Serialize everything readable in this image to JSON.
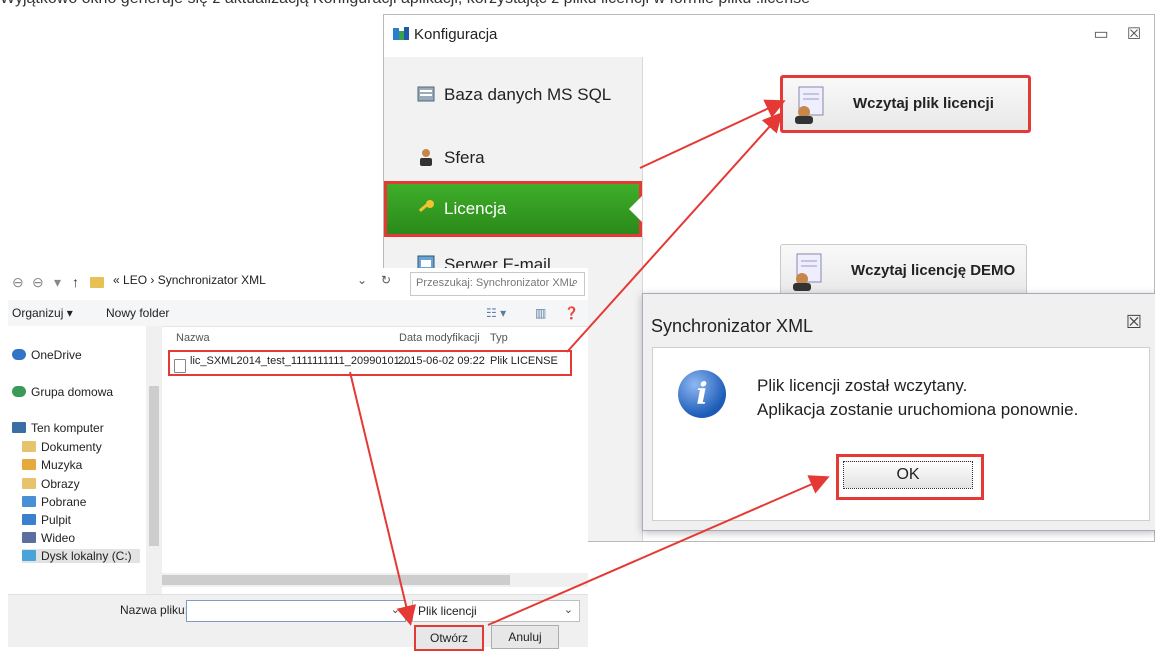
{
  "intro_text": "Wyjątkowo okno generuje się z aktualizacją Konfiguracji aplikacji, korzystając z pliku licencji w formie pliku .license",
  "konfiguracja": {
    "title": "Konfiguracja",
    "minimize": "▭",
    "close": "☒",
    "nav": [
      "Baza danych MS SQL",
      "Sfera",
      "Licencja",
      "Serwer E-mail"
    ],
    "active_index": 2,
    "buttons": {
      "load_license": "Wczytaj plik licencji",
      "load_demo": "Wczytaj licencję DEMO"
    }
  },
  "file_dialog": {
    "path": [
      "«",
      "LEO",
      "›",
      "Synchronizator XML"
    ],
    "search_placeholder": "Przeszukaj: Synchronizator XML",
    "toolbar": {
      "organize": "Organizuj ▾",
      "new_folder": "Nowy folder"
    },
    "tree": {
      "onedrive": "OneDrive",
      "homegroup": "Grupa domowa",
      "computer": "Ten komputer",
      "folders": [
        "Dokumenty",
        "Muzyka",
        "Obrazy",
        "Pobrane",
        "Pulpit",
        "Wideo",
        "Dysk lokalny (C:)"
      ]
    },
    "columns": {
      "name": "Nazwa",
      "date": "Data modyfikacji",
      "type": "Typ"
    },
    "file": {
      "name": "lic_SXML2014_test_1111111111_20990101....",
      "date": "2015-06-02 09:22",
      "type": "Plik LICENSE"
    },
    "filename_label": "Nazwa pliku:",
    "filename_value": "",
    "filter": "Plik licencji",
    "open": "Otwórz",
    "cancel": "Anuluj"
  },
  "message_box": {
    "title": "Synchronizator XML",
    "close": "☒",
    "line1": "Plik licencji został wczytany.",
    "line2": "Aplikacja zostanie uruchomiona ponownie.",
    "ok": "OK"
  },
  "colors": {
    "highlight": "#e53935",
    "active_nav": "#3fae2a"
  }
}
